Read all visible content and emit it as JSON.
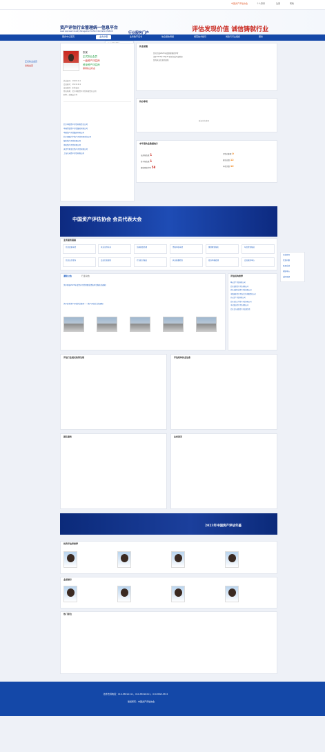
{
  "topbar": {
    "left": "中国资产评估协会",
    "links": [
      "个人登录",
      "注册",
      "帮助"
    ]
  },
  "header": {
    "title": "资产评估行业管理统一信息平台",
    "subtitle": "Asset Appraisal Industry Management Unified Information Platform",
    "badge": "行业服务门户",
    "slogan": "评估发现价值  诚信铸就行业",
    "sign": "——行业精神"
  },
  "nav": {
    "items": [
      "服务中心首页",
      "业务办理",
      "业务数字证书",
      "信息报告填报",
      "规范技术指引",
      "党建与行业组织",
      "服务"
    ],
    "active": "业务办理"
  },
  "dropdown": {
    "items": [
      "统计报表查询",
      "领取报表处理",
      "备案事项报送",
      "信息变更",
      "资质申请",
      "培训报名登记"
    ],
    "selected": "备案事项报送"
  },
  "sidebar": {
    "items": [
      "正式执业会员",
      "资格会员"
    ]
  },
  "profile": {
    "name": "张某",
    "type": "正式执业会员",
    "level": "一级资产评估师",
    "badge": "资深资产评估师",
    "status": "保持执业状态",
    "lines": [
      "执业编号：11001111",
      "会员编号：11111111",
      "会员类别：正式会员",
      "所在机构：北京中联资产评估有限责任公司",
      "职称：高级会计师"
    ]
  },
  "notices": {
    "title": "执业提醒",
    "lines": [
      "您已完成2023年度继续教育学时",
      "请于2023年12月31日前完成年度检查",
      "您的执业信息已更新"
    ]
  },
  "todo": {
    "title": "待办事项",
    "empty": "暂无待办事项"
  },
  "stats": {
    "title": "本年度执业数据统计",
    "items": [
      {
        "label": "出具报告数",
        "val": "1"
      },
      {
        "label": "签字报告数",
        "val": "1"
      },
      {
        "label": "继续教育学时",
        "val": "58"
      }
    ],
    "right": [
      {
        "label": "评估对象数",
        "val": "0"
      },
      {
        "label": "评估机构数",
        "val": "0"
      },
      {
        "label": "报告总数",
        "val": "12"
      },
      {
        "label": "签字总数",
        "val": "12"
      },
      {
        "label": "年检次数",
        "val": "12"
      }
    ]
  },
  "banner": {
    "text": "中国资产评估协会 会员代表大会"
  },
  "quick": {
    "title": "业务服务链接",
    "cards": [
      "信息变更申请",
      "执业证书补办",
      "注册备案办理",
      "资格审核申请",
      "继续教育报名",
      "年度检查报送",
      "信息公示查询",
      "会员信息更新",
      "行业统计报送",
      "执业质量检查",
      "投诉举报处理",
      "会员服务中心"
    ]
  },
  "rightside": {
    "items": [
      "在线咨询",
      "常见问题",
      "意见反馈",
      "帮助中心",
      "返回顶部"
    ]
  },
  "news": {
    "tabs": [
      "通知公告",
      "行业动态"
    ],
    "items": [
      "关于开展2023年度资产评估师职业资格考试报名的通知",
      "关于发布资产评估执业准则——资产评估方法的通知"
    ],
    "side_title": "评估机构推荐",
    "side": [
      "北京中联资产评估有限责任公司",
      "中瑞世联资产评估集团有限公司",
      "中联资产评估集团有限公司",
      "北京国融兴华资产评估有限责任公司",
      "银信资产评估有限公司",
      "中和资产评估有限公司",
      "天津华夏金信资产评估有限公司",
      "上海东洲资产评估有限公司",
      "坤元资产评估有限公司",
      "北京亚超资产评估有限公司",
      "北京天健兴业资产评估有限公司",
      "中铭国际资产评估(北京)有限责任公司",
      "开元资产评估有限公司",
      "北京卓信大华资产评估有限公司",
      "中水致远资产评估有限公司",
      "北京北方亚事资产评估事务所"
    ]
  },
  "lists": {
    "t1": "评估行业相关政策法规",
    "t2": "评估机构执业信息",
    "t3": "团队服务",
    "t4": "业务资讯"
  },
  "banner2": {
    "text": "2023年中国资产评估年鉴"
  },
  "experts": {
    "title": "优秀评估师推荐",
    "title2": "业绩展示",
    "title3": "热门职位"
  },
  "footer": {
    "line1": "技术支持电话：010-88191111，010-88192211，010-88214534",
    "line2": "版权所有：中国资产评估协会"
  }
}
